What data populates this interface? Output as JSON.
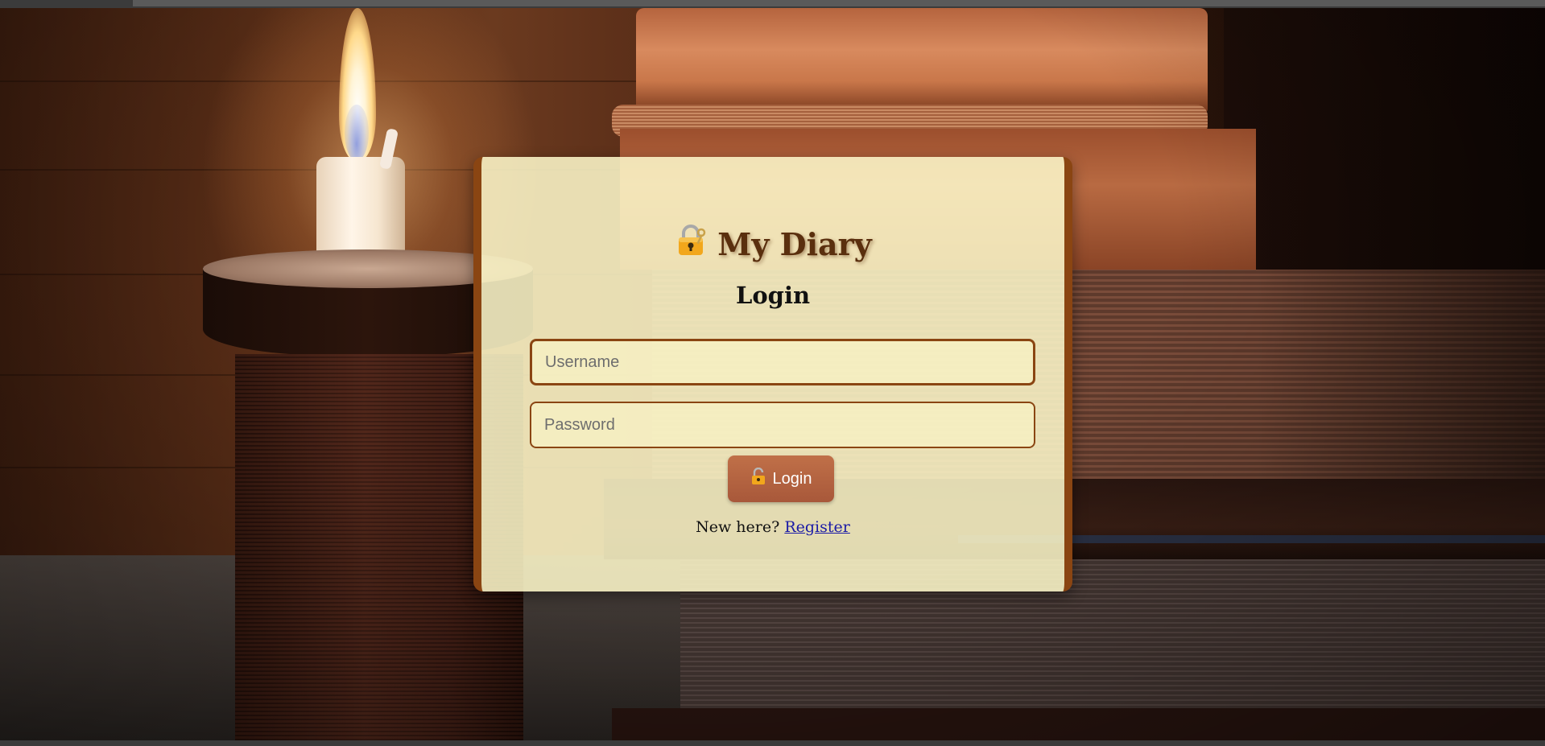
{
  "card": {
    "title": "My Diary",
    "title_icon": "lock-with-key-icon",
    "subtitle": "Login"
  },
  "form": {
    "username_placeholder": "Username",
    "password_placeholder": "Password",
    "login_label": "Login",
    "login_icon": "unlocked-padlock-icon"
  },
  "register": {
    "prompt": "New here?",
    "link_label": "Register"
  },
  "colors": {
    "card_background": "#fcf6c8",
    "card_border": "#8a4512",
    "title_color": "#5a2f0e",
    "button_color": "#b5603f",
    "link_color": "#1a1aa6"
  }
}
